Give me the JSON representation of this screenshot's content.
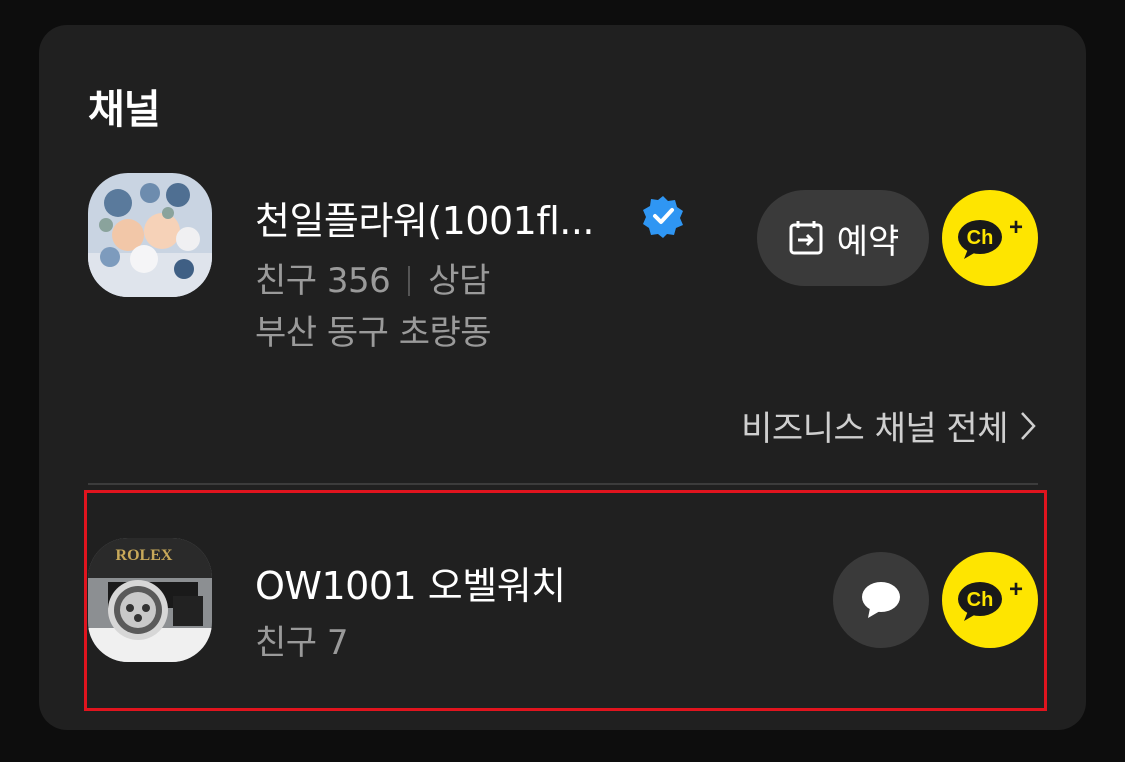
{
  "section": {
    "title": "채널"
  },
  "channels": [
    {
      "name": "천일플라워(1001fl...",
      "friends": "친구 356",
      "tag": "상담",
      "location": "부산 동구 초량동",
      "action_label": "예약",
      "thumb_icon": "flower-bouquet"
    },
    {
      "name": "OW1001 오벨워치",
      "friends": "친구 7",
      "thumb_icon": "rolex-watch",
      "thumb_text": "ROLEX"
    }
  ],
  "channel_add": {
    "label": "Ch",
    "plus": "+"
  },
  "business_link": {
    "label": "비즈니스 채널 전체"
  },
  "colors": {
    "background": "#0d0d0d",
    "card": "#202020",
    "kakao_yellow": "#fee500",
    "verified_blue": "#2f96f3",
    "highlight_red": "#e0141e"
  }
}
